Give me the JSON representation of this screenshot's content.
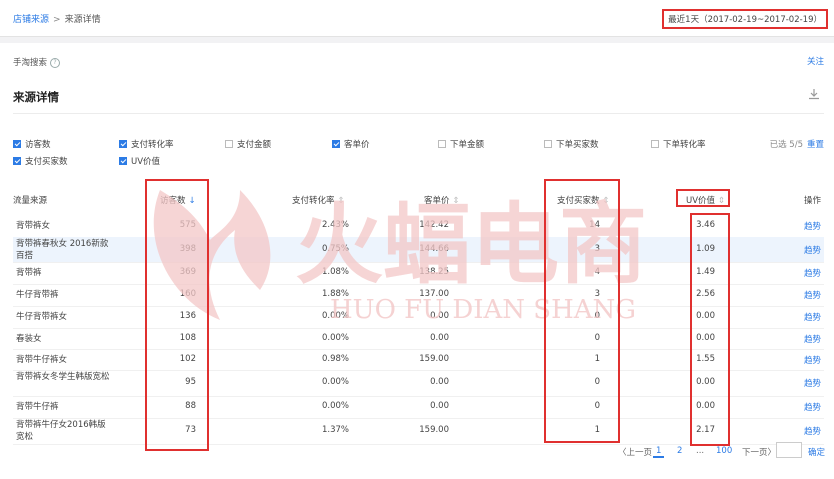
{
  "breadcrumb": {
    "root": "店铺来源",
    "sep": ">",
    "current": "来源详情"
  },
  "date_range": "最近1天（2017-02-19~2017-02-19）",
  "subheader": {
    "title": "手淘搜索",
    "follow": "关注"
  },
  "section": {
    "title": "来源详情"
  },
  "metrics": {
    "options": [
      {
        "label": "访客数",
        "checked": true
      },
      {
        "label": "支付转化率",
        "checked": true
      },
      {
        "label": "支付金额",
        "checked": false
      },
      {
        "label": "客单价",
        "checked": true
      },
      {
        "label": "下单金额",
        "checked": false
      },
      {
        "label": "下单买家数",
        "checked": false
      },
      {
        "label": "下单转化率",
        "checked": false
      },
      {
        "label": "支付买家数",
        "checked": true
      },
      {
        "label": "UV价值",
        "checked": true
      }
    ],
    "selected_count": "已选 5/5",
    "reset": "重置"
  },
  "table": {
    "headers": {
      "source": "流量来源",
      "visitors": "访客数",
      "conv": "支付转化率",
      "aov": "客单价",
      "buyers": "支付买家数",
      "uv": "UV价值",
      "action": "操作"
    },
    "rows": [
      {
        "source": "背带裤女",
        "visitors": "575",
        "conv": "2.43%",
        "aov": "142.42",
        "buyers": "14",
        "uv": "3.46",
        "action": "趋势"
      },
      {
        "source": "背带裤春秋女 2016新款 百搭",
        "visitors": "398",
        "conv": "0.75%",
        "aov": "144.66",
        "buyers": "3",
        "uv": "1.09",
        "action": "趋势"
      },
      {
        "source": "背带裤",
        "visitors": "369",
        "conv": "1.08%",
        "aov": "138.25",
        "buyers": "4",
        "uv": "1.49",
        "action": "趋势"
      },
      {
        "source": "牛仔背带裤",
        "visitors": "160",
        "conv": "1.88%",
        "aov": "137.00",
        "buyers": "3",
        "uv": "2.56",
        "action": "趋势"
      },
      {
        "source": "牛仔背带裤女",
        "visitors": "136",
        "conv": "0.00%",
        "aov": "0.00",
        "buyers": "0",
        "uv": "0.00",
        "action": "趋势"
      },
      {
        "source": "春装女",
        "visitors": "108",
        "conv": "0.00%",
        "aov": "0.00",
        "buyers": "0",
        "uv": "0.00",
        "action": "趋势"
      },
      {
        "source": "背带牛仔裤女",
        "visitors": "102",
        "conv": "0.98%",
        "aov": "159.00",
        "buyers": "1",
        "uv": "1.55",
        "action": "趋势"
      },
      {
        "source": "背带裤女冬学生韩版宽松",
        "visitors": "95",
        "conv": "0.00%",
        "aov": "0.00",
        "buyers": "0",
        "uv": "0.00",
        "action": "趋势"
      },
      {
        "source": "背带牛仔裤",
        "visitors": "88",
        "conv": "0.00%",
        "aov": "0.00",
        "buyers": "0",
        "uv": "0.00",
        "action": "趋势"
      },
      {
        "source": "背带裤牛仔女2016韩版 宽松",
        "visitors": "73",
        "conv": "1.37%",
        "aov": "159.00",
        "buyers": "1",
        "uv": "2.17",
        "action": "趋势"
      }
    ]
  },
  "pagination": {
    "prev": "〈上一页",
    "p1": "1",
    "p2": "2",
    "ellipsis": "...",
    "last": "100",
    "next": "下一页〉",
    "confirm": "确定"
  },
  "watermark": {
    "cn": "火蝠电商",
    "en": "HUO FU DIAN SHANG"
  },
  "colors": {
    "accent": "#2c7be5",
    "highlight_box": "#e0302f",
    "watermark": "#f3c7c7"
  }
}
